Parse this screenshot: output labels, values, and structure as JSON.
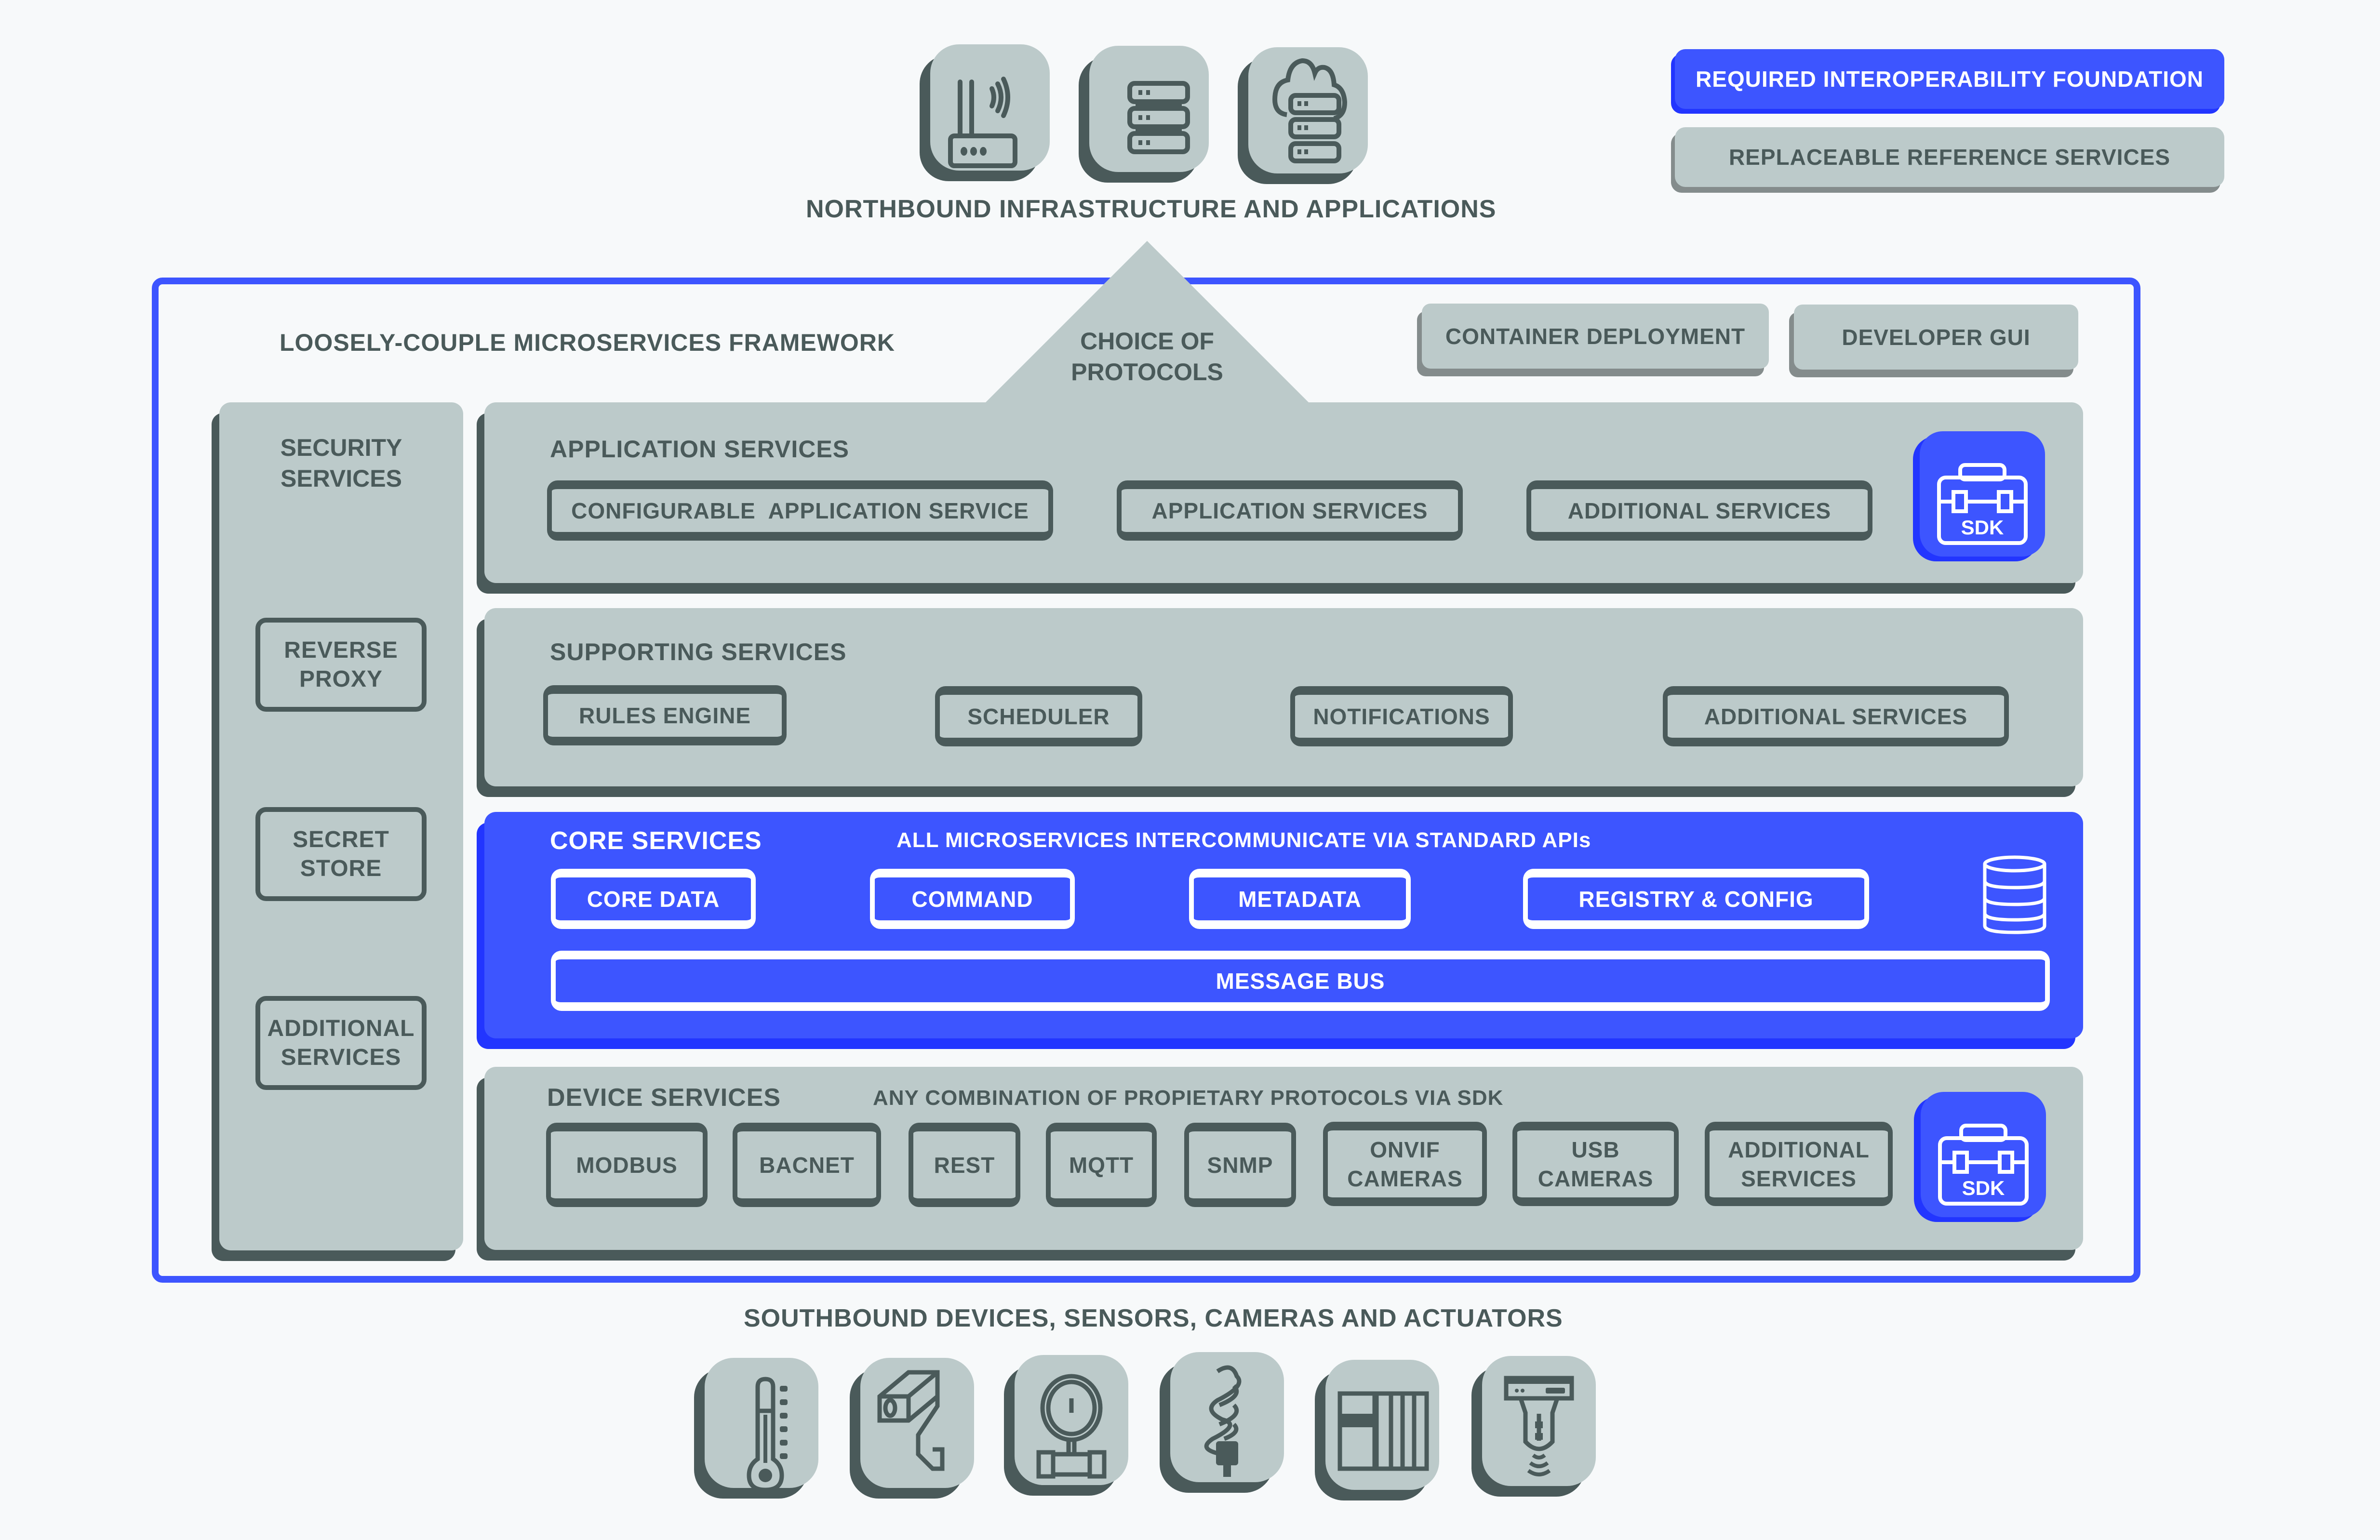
{
  "legend": {
    "required": "REQUIRED INTEROPERABILITY FOUNDATION",
    "replaceable": "REPLACEABLE REFERENCE SERVICES",
    "colors": {
      "required": "#3d55ff",
      "replaceable": "#bccaca",
      "text": "#4a5a5a"
    }
  },
  "northbound": {
    "label": "NORTHBOUND INFRASTRUCTURE AND APPLICATIONS",
    "icons": [
      "router-icon",
      "server-icon",
      "cloud-server-icon"
    ]
  },
  "framework": {
    "title": "LOOSELY-COUPLE MICROSERVICES FRAMEWORK",
    "protocols_label_line1": "CHOICE OF",
    "protocols_label_line2": "PROTOCOLS",
    "container_deployment": "CONTAINER DEPLOYMENT",
    "developer_gui": "DEVELOPER GUI"
  },
  "security": {
    "title_line1": "SECURITY",
    "title_line2": "SERVICES",
    "items": [
      {
        "line1": "REVERSE",
        "line2": "PROXY"
      },
      {
        "line1": "SECRET",
        "line2": "STORE"
      },
      {
        "line1": "ADDITIONAL",
        "line2": "SERVICES"
      }
    ]
  },
  "application_services": {
    "title": "APPLICATION SERVICES",
    "items": [
      "CONFIGURABLE  APPLICATION SERVICE",
      "APPLICATION SERVICES",
      "ADDITIONAL SERVICES"
    ],
    "sdk_label": "SDK"
  },
  "supporting_services": {
    "title": "SUPPORTING SERVICES",
    "items": [
      "RULES ENGINE",
      "SCHEDULER",
      "NOTIFICATIONS",
      "ADDITIONAL SERVICES"
    ]
  },
  "core_services": {
    "title": "CORE SERVICES",
    "subtitle": "ALL MICROSERVICES INTERCOMMUNICATE VIA STANDARD APIs",
    "items": [
      "CORE DATA",
      "COMMAND",
      "METADATA",
      "REGISTRY & CONFIG"
    ],
    "message_bus": "MESSAGE BUS"
  },
  "device_services": {
    "title": "DEVICE SERVICES",
    "subtitle": "ANY COMBINATION OF PROPIETARY PROTOCOLS VIA SDK",
    "items": [
      {
        "line1": "MODBUS",
        "line2": ""
      },
      {
        "line1": "BACNET",
        "line2": ""
      },
      {
        "line1": "REST",
        "line2": ""
      },
      {
        "line1": "MQTT",
        "line2": ""
      },
      {
        "line1": "SNMP",
        "line2": ""
      },
      {
        "line1": "ONVIF",
        "line2": "CAMERAS"
      },
      {
        "line1": "USB",
        "line2": "CAMERAS"
      },
      {
        "line1": "ADDITIONAL",
        "line2": "SERVICES"
      }
    ],
    "sdk_label": "SDK"
  },
  "southbound": {
    "label": "SOUTHBOUND DEVICES, SENSORS, CAMERAS  AND ACTUATORS",
    "icons": [
      "thermometer-icon",
      "security-camera-icon",
      "pressure-gauge-icon",
      "light-bulb-icon",
      "plc-controller-icon",
      "sensor-actuator-icon"
    ]
  }
}
